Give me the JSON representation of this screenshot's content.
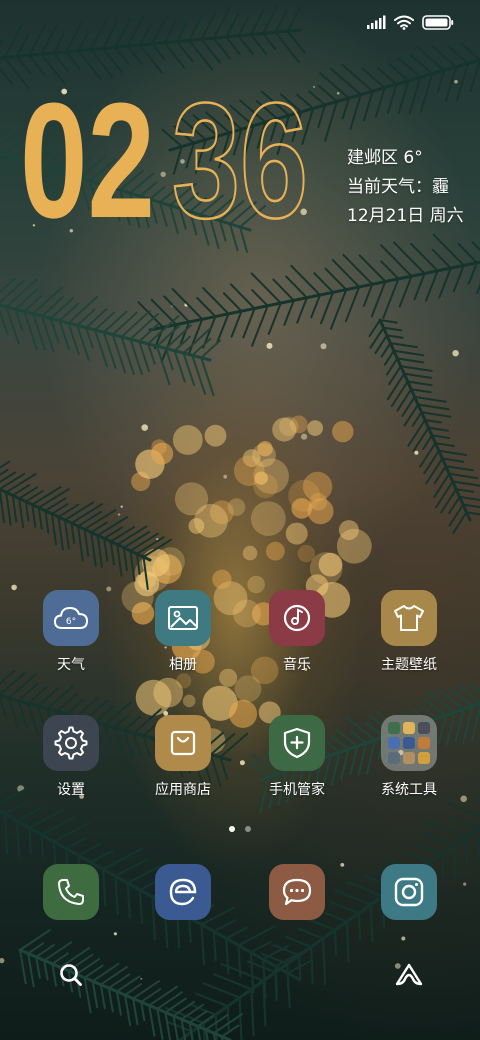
{
  "status_bar": {
    "signal_icon": "signal-icon",
    "wifi_icon": "wifi-icon",
    "battery_icon": "battery-icon"
  },
  "clock": {
    "hours": "02",
    "minutes": "36",
    "colors": {
      "hours_fill": "#e8b155",
      "minutes_outline": "#e8b155"
    }
  },
  "weather_widget": {
    "location_temp": "建邺区 6°",
    "condition": "当前天气：霾",
    "date": "12月21日 周六"
  },
  "apps": [
    {
      "name": "天气",
      "icon": "cloud-6-icon",
      "color": "#4f6c96"
    },
    {
      "name": "相册",
      "icon": "picture-icon",
      "color": "#3f7a82"
    },
    {
      "name": "音乐",
      "icon": "music-disc-icon",
      "color": "#8a3b45"
    },
    {
      "name": "主题壁纸",
      "icon": "tshirt-icon",
      "color": "#a8884a"
    },
    {
      "name": "设置",
      "icon": "gear-icon",
      "color": "#3d4650"
    },
    {
      "name": "应用商店",
      "icon": "shopping-bag-icon",
      "color": "#b08a4a"
    },
    {
      "name": "手机管家",
      "icon": "shield-plus-icon",
      "color": "#3d6a44"
    },
    {
      "name": "系统工具",
      "icon": "folder-icon",
      "color": "#8a8a88"
    }
  ],
  "page_indicator": {
    "pages": 2,
    "current": 1
  },
  "dock": [
    {
      "icon": "phone-icon",
      "color": "#3e6b40"
    },
    {
      "icon": "browser-e-icon",
      "color": "#3c5a92"
    },
    {
      "icon": "message-icon",
      "color": "#8d5a43"
    },
    {
      "icon": "camera-icon",
      "color": "#3d7a86"
    }
  ],
  "bottom_bar": {
    "left_icon": "search-icon",
    "right_icon": "assistant-icon"
  }
}
